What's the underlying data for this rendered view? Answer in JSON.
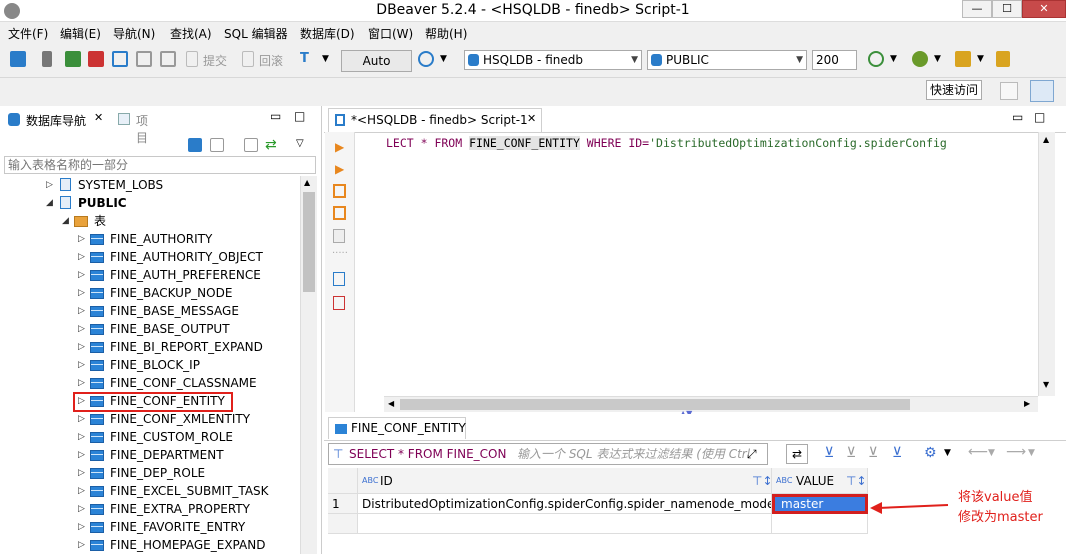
{
  "window": {
    "title": "DBeaver 5.2.4 - <HSQLDB - finedb> Script-1"
  },
  "menu": [
    "文件(F)",
    "编辑(E)",
    "导航(N)",
    "查找(A)",
    "SQL 编辑器",
    "数据库(D)",
    "窗口(W)",
    "帮助(H)"
  ],
  "toolbar": {
    "submit_label": "提交",
    "rollback_label": "回滚",
    "auto_label": "Auto",
    "datasource": "HSQLDB - finedb",
    "schema": "PUBLIC",
    "fetch_size": "200",
    "quick_access": "快速访问"
  },
  "navigator": {
    "tab_label": "数据库导航",
    "projects_label": "项目",
    "filter_placeholder": "输入表格名称的一部分",
    "tree": {
      "system_lobs": "SYSTEM_LOBS",
      "public": "PUBLIC",
      "tables_folder": "表",
      "tables": [
        "FINE_AUTHORITY",
        "FINE_AUTHORITY_OBJECT",
        "FINE_AUTH_PREFERENCE",
        "FINE_BACKUP_NODE",
        "FINE_BASE_MESSAGE",
        "FINE_BASE_OUTPUT",
        "FINE_BI_REPORT_EXPAND",
        "FINE_BLOCK_IP",
        "FINE_CONF_CLASSNAME",
        "FINE_CONF_ENTITY",
        "FINE_CONF_XMLENTITY",
        "FINE_CUSTOM_ROLE",
        "FINE_DEPARTMENT",
        "FINE_DEP_ROLE",
        "FINE_EXCEL_SUBMIT_TASK",
        "FINE_EXTRA_PROPERTY",
        "FINE_FAVORITE_ENTRY",
        "FINE_HOMEPAGE_EXPAND"
      ]
    }
  },
  "editor": {
    "tab_label": "*<HSQLDB - finedb> Script-1",
    "sql": {
      "kw1": "LECT * FROM ",
      "table": "FINE_CONF_ENTITY",
      "kw2": " WHERE ID=",
      "value": "'DistributedOptimizationConfig.spiderConfig"
    }
  },
  "results": {
    "tab_label": "FINE_CONF_ENTITY",
    "filter_sql": "SELECT * FROM FINE_CON",
    "filter_placeholder": "输入一个 SQL 表达式来过滤结果 (使用 Ctrl",
    "columns": [
      "ID",
      "VALUE"
    ],
    "col_type_badge": "ABC",
    "rows": [
      {
        "num": "1",
        "id": "DistributedOptimizationConfig.spiderConfig.spider_namenode_mode",
        "value": "master"
      }
    ]
  },
  "annotation": {
    "line1": "将该value值",
    "line2": "修改为master",
    "color": "#e0201b"
  }
}
